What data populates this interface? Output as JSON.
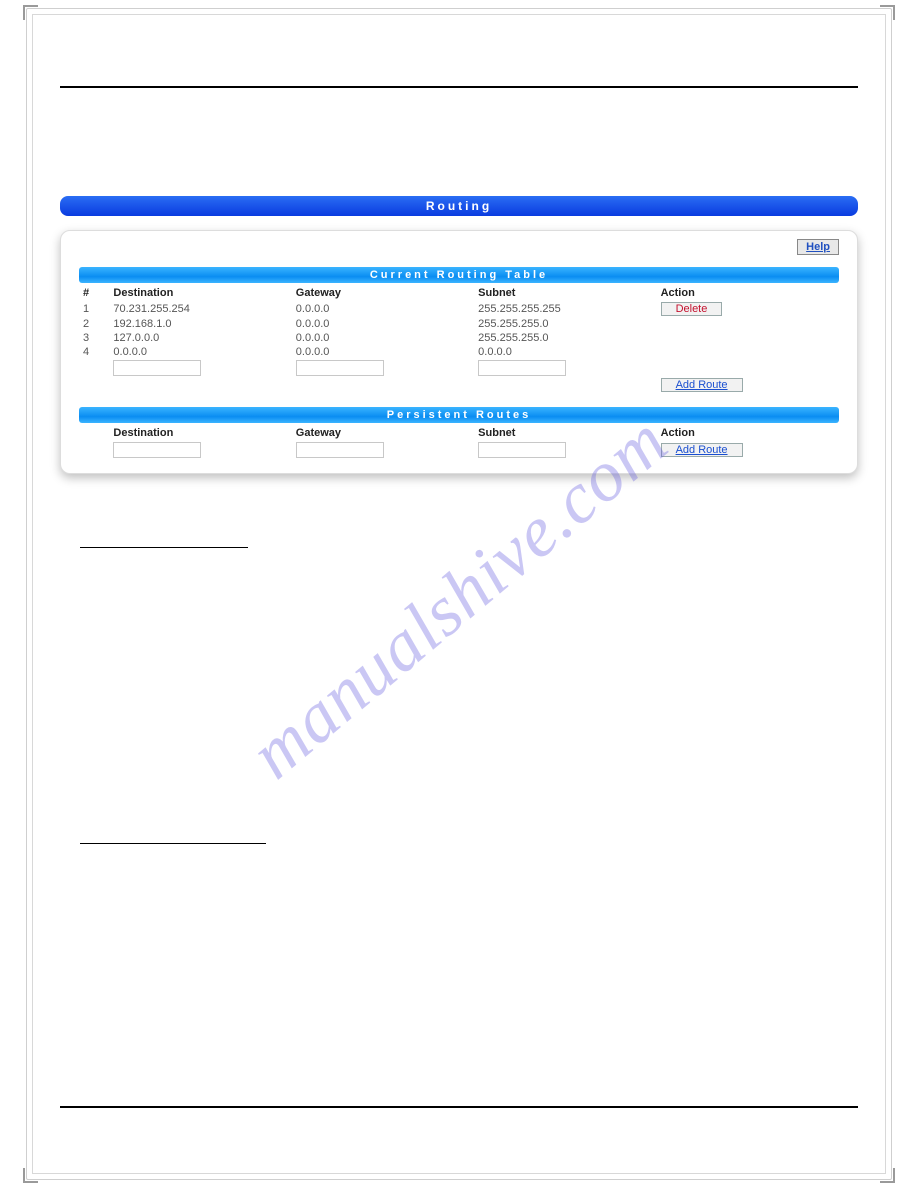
{
  "watermark": "manualshive.com",
  "title_bar": "Routing",
  "help_label": "Help",
  "section_current": "Current Routing Table",
  "section_persistent": "Persistent Routes",
  "headers": {
    "num": "#",
    "destination": "Destination",
    "gateway": "Gateway",
    "subnet": "Subnet",
    "action": "Action"
  },
  "routes": [
    {
      "n": "1",
      "dest": "70.231.255.254",
      "gw": "0.0.0.0",
      "sub": "255.255.255.255"
    },
    {
      "n": "2",
      "dest": "192.168.1.0",
      "gw": "0.0.0.0",
      "sub": "255.255.255.0"
    },
    {
      "n": "3",
      "dest": "127.0.0.0",
      "gw": "0.0.0.0",
      "sub": "255.255.255.0"
    },
    {
      "n": "4",
      "dest": "0.0.0.0",
      "gw": "0.0.0.0",
      "sub": "0.0.0.0"
    }
  ],
  "buttons": {
    "delete": "Delete",
    "add": "Add Route"
  }
}
